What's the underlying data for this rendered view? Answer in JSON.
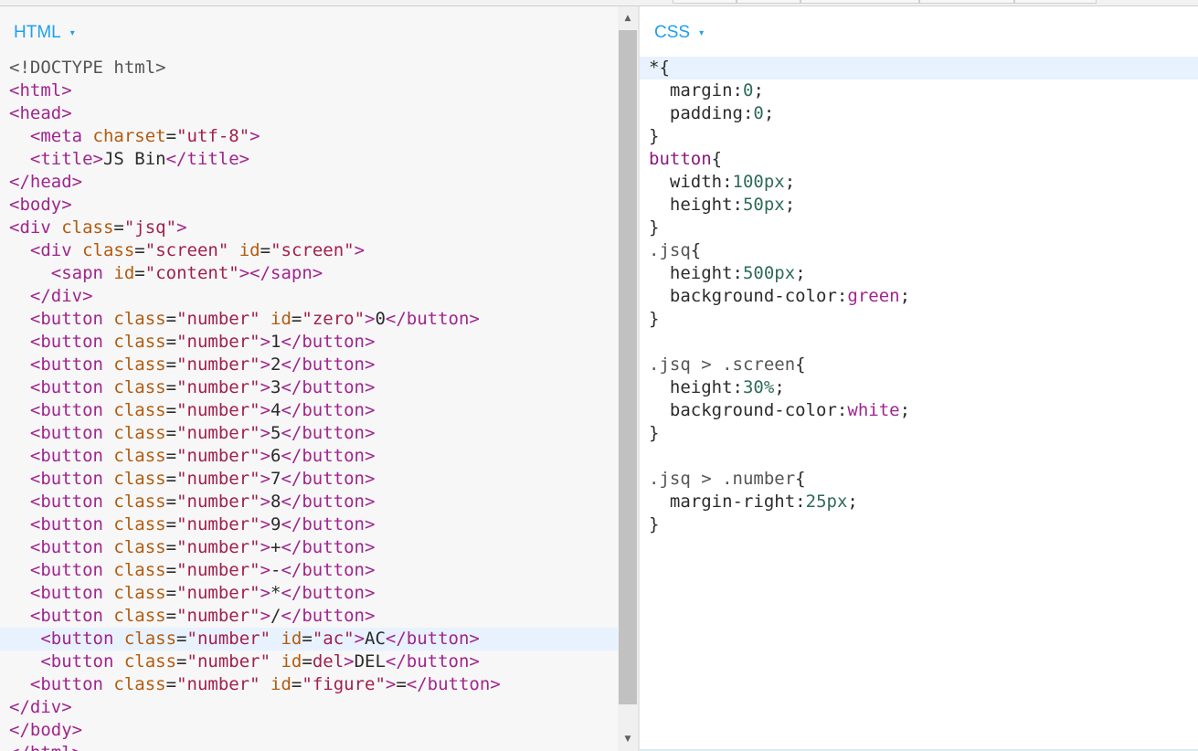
{
  "html_panel": {
    "label": "HTML",
    "caret": "▾",
    "lines": [
      [
        [
          "doc",
          "<!DOCTYPE html>"
        ]
      ],
      [
        [
          "tag",
          "<html>"
        ]
      ],
      [
        [
          "tag",
          "<head>"
        ]
      ],
      [
        [
          "text",
          "  "
        ],
        [
          "tag",
          "<meta "
        ],
        [
          "attr",
          "charset"
        ],
        [
          "text",
          "="
        ],
        [
          "str",
          "\"utf-8\""
        ],
        [
          "tag",
          ">"
        ]
      ],
      [
        [
          "text",
          "  "
        ],
        [
          "tag",
          "<title>"
        ],
        [
          "text",
          "JS Bin"
        ],
        [
          "tag",
          "</title>"
        ]
      ],
      [
        [
          "tag",
          "</head>"
        ]
      ],
      [
        [
          "tag",
          "<body>"
        ]
      ],
      [
        [
          "tag",
          "<div "
        ],
        [
          "attr",
          "class"
        ],
        [
          "text",
          "="
        ],
        [
          "str",
          "\"jsq\""
        ],
        [
          "tag",
          ">"
        ]
      ],
      [
        [
          "text",
          "  "
        ],
        [
          "tag",
          "<div "
        ],
        [
          "attr",
          "class"
        ],
        [
          "text",
          "="
        ],
        [
          "str",
          "\"screen\""
        ],
        [
          "text",
          " "
        ],
        [
          "attr",
          "id"
        ],
        [
          "text",
          "="
        ],
        [
          "str",
          "\"screen\""
        ],
        [
          "tag",
          ">"
        ]
      ],
      [
        [
          "text",
          "    "
        ],
        [
          "tag",
          "<sapn "
        ],
        [
          "attr",
          "id"
        ],
        [
          "text",
          "="
        ],
        [
          "str",
          "\"content\""
        ],
        [
          "tag",
          "></sapn>"
        ]
      ],
      [
        [
          "text",
          "  "
        ],
        [
          "tag",
          "</div>"
        ]
      ],
      [
        [
          "text",
          "  "
        ],
        [
          "tag",
          "<button "
        ],
        [
          "attr",
          "class"
        ],
        [
          "text",
          "="
        ],
        [
          "str",
          "\"number\""
        ],
        [
          "text",
          " "
        ],
        [
          "attr",
          "id"
        ],
        [
          "text",
          "="
        ],
        [
          "str",
          "\"zero\""
        ],
        [
          "tag",
          ">"
        ],
        [
          "text",
          "0"
        ],
        [
          "tag",
          "</button>"
        ]
      ],
      [
        [
          "text",
          "  "
        ],
        [
          "tag",
          "<button "
        ],
        [
          "attr",
          "class"
        ],
        [
          "text",
          "="
        ],
        [
          "str",
          "\"number\""
        ],
        [
          "tag",
          ">"
        ],
        [
          "text",
          "1"
        ],
        [
          "tag",
          "</button>"
        ]
      ],
      [
        [
          "text",
          "  "
        ],
        [
          "tag",
          "<button "
        ],
        [
          "attr",
          "class"
        ],
        [
          "text",
          "="
        ],
        [
          "str",
          "\"number\""
        ],
        [
          "tag",
          ">"
        ],
        [
          "text",
          "2"
        ],
        [
          "tag",
          "</button>"
        ]
      ],
      [
        [
          "text",
          "  "
        ],
        [
          "tag",
          "<button "
        ],
        [
          "attr",
          "class"
        ],
        [
          "text",
          "="
        ],
        [
          "str",
          "\"number\""
        ],
        [
          "tag",
          ">"
        ],
        [
          "text",
          "3"
        ],
        [
          "tag",
          "</button>"
        ]
      ],
      [
        [
          "text",
          "  "
        ],
        [
          "tag",
          "<button "
        ],
        [
          "attr",
          "class"
        ],
        [
          "text",
          "="
        ],
        [
          "str",
          "\"number\""
        ],
        [
          "tag",
          ">"
        ],
        [
          "text",
          "4"
        ],
        [
          "tag",
          "</button>"
        ]
      ],
      [
        [
          "text",
          "  "
        ],
        [
          "tag",
          "<button "
        ],
        [
          "attr",
          "class"
        ],
        [
          "text",
          "="
        ],
        [
          "str",
          "\"number\""
        ],
        [
          "tag",
          ">"
        ],
        [
          "text",
          "5"
        ],
        [
          "tag",
          "</button>"
        ]
      ],
      [
        [
          "text",
          "  "
        ],
        [
          "tag",
          "<button "
        ],
        [
          "attr",
          "class"
        ],
        [
          "text",
          "="
        ],
        [
          "str",
          "\"number\""
        ],
        [
          "tag",
          ">"
        ],
        [
          "text",
          "6"
        ],
        [
          "tag",
          "</button>"
        ]
      ],
      [
        [
          "text",
          "  "
        ],
        [
          "tag",
          "<button "
        ],
        [
          "attr",
          "class"
        ],
        [
          "text",
          "="
        ],
        [
          "str",
          "\"number\""
        ],
        [
          "tag",
          ">"
        ],
        [
          "text",
          "7"
        ],
        [
          "tag",
          "</button>"
        ]
      ],
      [
        [
          "text",
          "  "
        ],
        [
          "tag",
          "<button "
        ],
        [
          "attr",
          "class"
        ],
        [
          "text",
          "="
        ],
        [
          "str",
          "\"number\""
        ],
        [
          "tag",
          ">"
        ],
        [
          "text",
          "8"
        ],
        [
          "tag",
          "</button>"
        ]
      ],
      [
        [
          "text",
          "  "
        ],
        [
          "tag",
          "<button "
        ],
        [
          "attr",
          "class"
        ],
        [
          "text",
          "="
        ],
        [
          "str",
          "\"number\""
        ],
        [
          "tag",
          ">"
        ],
        [
          "text",
          "9"
        ],
        [
          "tag",
          "</button>"
        ]
      ],
      [
        [
          "text",
          "  "
        ],
        [
          "tag",
          "<button "
        ],
        [
          "attr",
          "class"
        ],
        [
          "text",
          "="
        ],
        [
          "str",
          "\"number\""
        ],
        [
          "tag",
          ">"
        ],
        [
          "text",
          "+"
        ],
        [
          "tag",
          "</button>"
        ]
      ],
      [
        [
          "text",
          "  "
        ],
        [
          "tag",
          "<button "
        ],
        [
          "attr",
          "class"
        ],
        [
          "text",
          "="
        ],
        [
          "str",
          "\"number\""
        ],
        [
          "tag",
          ">"
        ],
        [
          "text",
          "-"
        ],
        [
          "tag",
          "</button>"
        ]
      ],
      [
        [
          "text",
          "  "
        ],
        [
          "tag",
          "<button "
        ],
        [
          "attr",
          "class"
        ],
        [
          "text",
          "="
        ],
        [
          "str",
          "\"number\""
        ],
        [
          "tag",
          ">"
        ],
        [
          "text",
          "*"
        ],
        [
          "tag",
          "</button>"
        ]
      ],
      [
        [
          "text",
          "  "
        ],
        [
          "tag",
          "<button "
        ],
        [
          "attr",
          "class"
        ],
        [
          "text",
          "="
        ],
        [
          "str",
          "\"number\""
        ],
        [
          "tag",
          ">"
        ],
        [
          "text",
          "/"
        ],
        [
          "tag",
          "</button>"
        ]
      ],
      [
        [
          "text",
          "   "
        ],
        [
          "tag",
          "<button "
        ],
        [
          "attr",
          "class"
        ],
        [
          "text",
          "="
        ],
        [
          "str",
          "\"number\""
        ],
        [
          "text",
          " "
        ],
        [
          "attr",
          "id"
        ],
        [
          "text",
          "="
        ],
        [
          "str",
          "\"ac\""
        ],
        [
          "tag",
          ">"
        ],
        [
          "text",
          "AC"
        ],
        [
          "tag",
          "</button>"
        ]
      ],
      [
        [
          "text",
          "   "
        ],
        [
          "tag",
          "<button "
        ],
        [
          "attr",
          "class"
        ],
        [
          "text",
          "="
        ],
        [
          "str",
          "\"number\""
        ],
        [
          "text",
          " "
        ],
        [
          "attr",
          "id"
        ],
        [
          "text",
          "="
        ],
        [
          "str",
          "del"
        ],
        [
          "tag",
          ">"
        ],
        [
          "text",
          "DEL"
        ],
        [
          "tag",
          "</button>"
        ]
      ],
      [
        [
          "text",
          "  "
        ],
        [
          "tag",
          "<button "
        ],
        [
          "attr",
          "class"
        ],
        [
          "text",
          "="
        ],
        [
          "str",
          "\"number\""
        ],
        [
          "text",
          " "
        ],
        [
          "attr",
          "id"
        ],
        [
          "text",
          "="
        ],
        [
          "str",
          "\"figure\""
        ],
        [
          "tag",
          ">"
        ],
        [
          "text",
          "="
        ],
        [
          "tag",
          "</button>"
        ]
      ],
      [
        [
          "tag",
          "</div>"
        ]
      ],
      [
        [
          "tag",
          "</body>"
        ]
      ],
      [
        [
          "tag",
          "</html>"
        ]
      ]
    ],
    "active_line": 25
  },
  "css_panel": {
    "label": "CSS",
    "caret": "▾",
    "lines": [
      [
        [
          "punc",
          "*{"
        ]
      ],
      [
        [
          "text",
          "  "
        ],
        [
          "prop",
          "margin"
        ],
        [
          "punc",
          ":"
        ],
        [
          "num",
          "0"
        ],
        [
          "punc",
          ";"
        ]
      ],
      [
        [
          "text",
          "  "
        ],
        [
          "prop",
          "padding"
        ],
        [
          "punc",
          ":"
        ],
        [
          "num",
          "0"
        ],
        [
          "punc",
          ";"
        ]
      ],
      [
        [
          "punc",
          "}"
        ]
      ],
      [
        [
          "sel",
          "button"
        ],
        [
          "punc",
          "{"
        ]
      ],
      [
        [
          "text",
          "  "
        ],
        [
          "prop",
          "width"
        ],
        [
          "punc",
          ":"
        ],
        [
          "num",
          "100px"
        ],
        [
          "punc",
          ";"
        ]
      ],
      [
        [
          "text",
          "  "
        ],
        [
          "prop",
          "height"
        ],
        [
          "punc",
          ":"
        ],
        [
          "num",
          "50px"
        ],
        [
          "punc",
          ";"
        ]
      ],
      [
        [
          "punc",
          "}"
        ]
      ],
      [
        [
          "cls",
          ".jsq"
        ],
        [
          "punc",
          "{"
        ]
      ],
      [
        [
          "text",
          "  "
        ],
        [
          "prop",
          "height"
        ],
        [
          "punc",
          ":"
        ],
        [
          "num",
          "500px"
        ],
        [
          "punc",
          ";"
        ]
      ],
      [
        [
          "text",
          "  "
        ],
        [
          "prop",
          "background-color"
        ],
        [
          "punc",
          ":"
        ],
        [
          "kw",
          "green"
        ],
        [
          "punc",
          ";"
        ]
      ],
      [
        [
          "punc",
          "}"
        ]
      ],
      [
        [
          "text",
          ""
        ]
      ],
      [
        [
          "cls",
          ".jsq > .screen"
        ],
        [
          "punc",
          "{"
        ]
      ],
      [
        [
          "text",
          "  "
        ],
        [
          "prop",
          "height"
        ],
        [
          "punc",
          ":"
        ],
        [
          "num",
          "30%"
        ],
        [
          "punc",
          ";"
        ]
      ],
      [
        [
          "text",
          "  "
        ],
        [
          "prop",
          "background-color"
        ],
        [
          "punc",
          ":"
        ],
        [
          "kw",
          "white"
        ],
        [
          "punc",
          ";"
        ]
      ],
      [
        [
          "punc",
          "}"
        ]
      ],
      [
        [
          "text",
          ""
        ]
      ],
      [
        [
          "cls",
          ".jsq > .number"
        ],
        [
          "punc",
          "{"
        ]
      ],
      [
        [
          "text",
          "  "
        ],
        [
          "prop",
          "margin-right"
        ],
        [
          "punc",
          ":"
        ],
        [
          "num",
          "25px"
        ],
        [
          "punc",
          ";"
        ]
      ],
      [
        [
          "punc",
          "}"
        ]
      ]
    ],
    "active_line": 0
  },
  "scrollbar": {
    "up_arrow": "▲",
    "down_arrow": "▼"
  }
}
